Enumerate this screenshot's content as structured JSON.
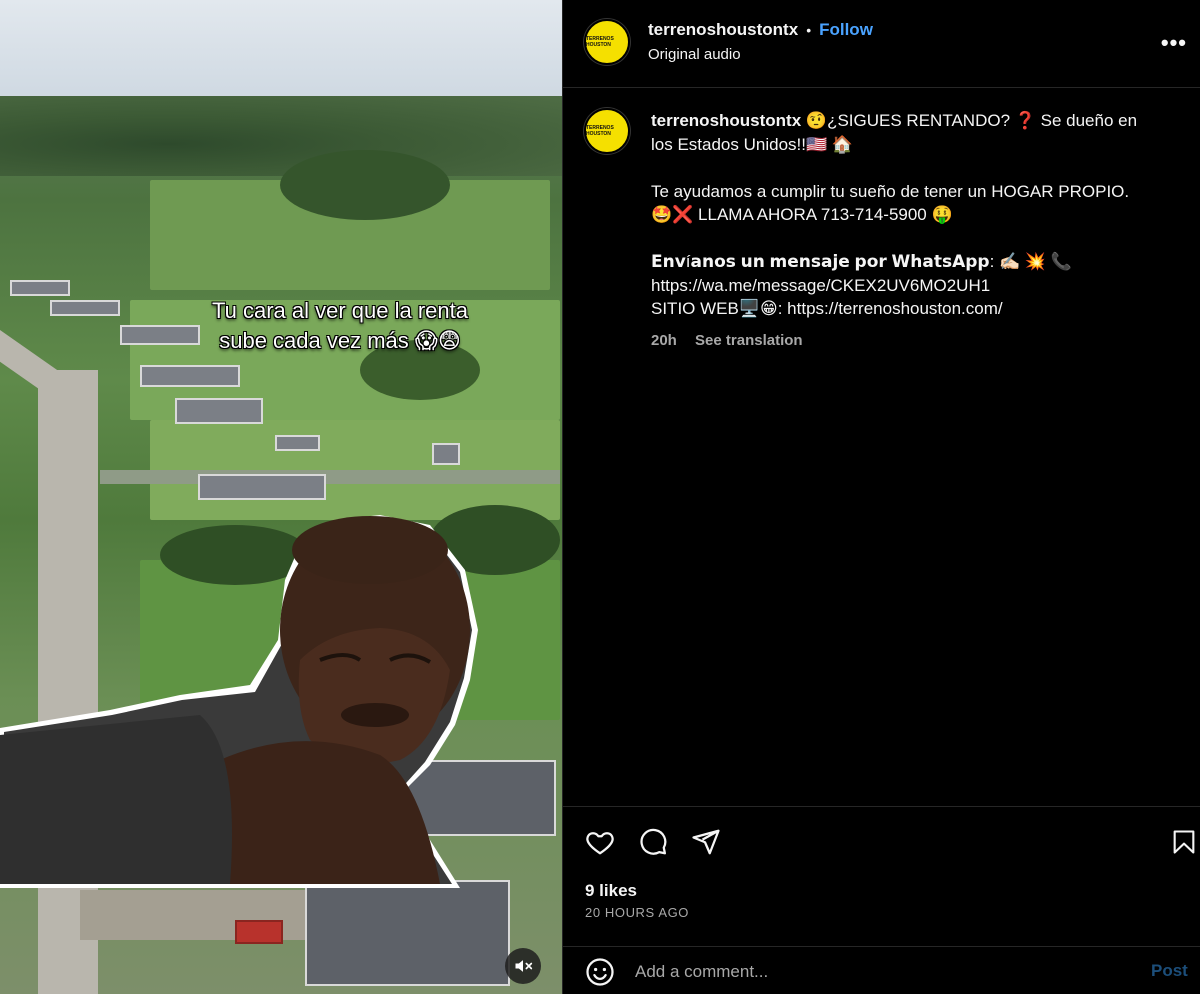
{
  "video": {
    "overlay_text_line1": "Tu cara al ver que la renta",
    "overlay_text_line2": "sube cada vez más 😱😨",
    "mute_icon": "speaker-muted-icon"
  },
  "header": {
    "avatar_text": "TERRENOS HOUSTON",
    "username": "terrenoshoustontx",
    "separator": "•",
    "follow_label": "Follow",
    "audio": "Original audio",
    "more_label": "•••"
  },
  "caption": {
    "username": "terrenoshoustontx",
    "line1": "🤨¿SIGUES RENTANDO? ❓ Se dueño en",
    "line2": "los Estados Unidos!!🇺🇸 🏠",
    "line3": "Te ayudamos a cumplir tu sueño de tener un HOGAR PROPIO.",
    "line4": "🤩❌ LLAMA AHORA 713-714-5900 🤑",
    "line5_bold": "𝗘𝗻𝘃í𝗮𝗻𝗼𝘀 𝘂𝗻 𝗺𝗲𝗻𝘀𝗮𝗷𝗲 𝗽𝗼𝗿 𝗪𝗵𝗮𝘁𝘀𝗔𝗽𝗽:",
    "line5_emoji": " ✍🏻 💥 📞",
    "line6": "https://wa.me/message/CKEX2UV6MO2UH1",
    "line7": "SITIO WEB🖥️😁: https://terrenoshouston.com/",
    "age": "20h",
    "translate": "See translation"
  },
  "actions": {
    "likes": "9 likes",
    "timestamp": "20 HOURS AGO"
  },
  "comment": {
    "placeholder": "Add a comment...",
    "post_label": "Post"
  },
  "colors": {
    "accent": "#4aa3ff",
    "avatar_bg": "#f5e000",
    "background": "#000000",
    "divider": "#262626"
  }
}
